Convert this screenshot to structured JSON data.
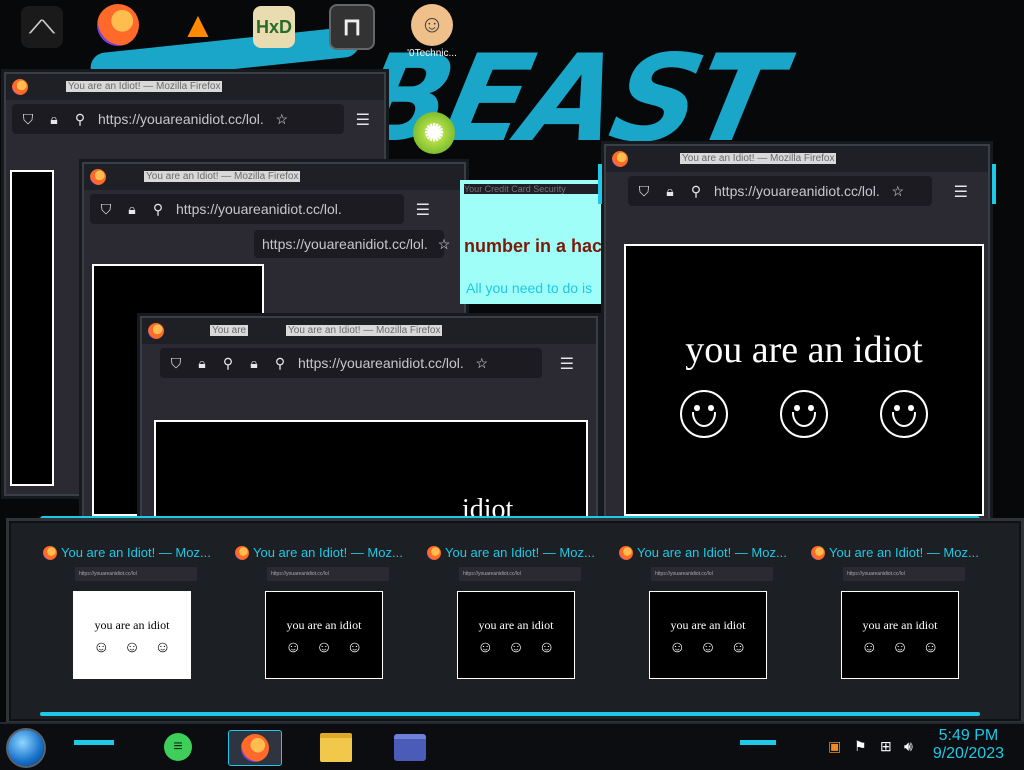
{
  "desktop": {
    "icons": [
      {
        "name": "app-shortcut-icon",
        "caption": ""
      },
      {
        "name": "firefox-shortcut-icon",
        "caption": ""
      },
      {
        "name": "vlc-shortcut-icon",
        "caption": ""
      },
      {
        "name": "hxd-shortcut-icon",
        "caption": ""
      },
      {
        "name": "map-shortcut-icon",
        "caption": ""
      },
      {
        "name": "technician-shortcut-icon",
        "caption": "'0Technic..."
      }
    ],
    "wallpaper_text": "BEAST"
  },
  "windows": {
    "w1": {
      "title": "You are an Idiot! — Mozilla Firefox",
      "url": "https://youareanidiot.cc/lol."
    },
    "w2": {
      "title": "You are an Idiot! — Mozilla Firefox",
      "url": "https://youareanidiot.cc/lol."
    },
    "w2b": {
      "url": "https://youareanidiot.cc/lol."
    },
    "w3": {
      "title": "You are an Idiot! — Mozilla Firefox",
      "title_fragment": "You are",
      "url": "https://youareanidiot.cc/lol."
    },
    "w4": {
      "title": "You are an Idiot! — Mozilla Firefox",
      "url": "https://youareanidiot.cc/lol.",
      "page_text": "you are an idiot"
    },
    "stray_text": "idiot"
  },
  "ad_popup": {
    "title": "Your Credit Card Security",
    "headline": "number in a hac",
    "body": "All you need to do is"
  },
  "previews": [
    {
      "title": "You are an Idiot! — Moz...",
      "url": "https://youareanidiot.cc/lol",
      "text": "you are an idiot",
      "inverted": true
    },
    {
      "title": "You are an Idiot! — Moz...",
      "url": "https://youareanidiot.cc/lol",
      "text": "you are an idiot",
      "inverted": false
    },
    {
      "title": "You are an Idiot! — Moz...",
      "url": "https://youareanidiot.cc/lol",
      "text": "you are an idiot",
      "inverted": false
    },
    {
      "title": "You are an Idiot! — Moz...",
      "url": "https://youareanidiot.cc/lol",
      "text": "you are an idiot",
      "inverted": false
    },
    {
      "title": "You are an Idiot! — Moz...",
      "url": "https://youareanidiot.cc/lol",
      "text": "you are an idiot",
      "inverted": false
    }
  ],
  "taskbar": {
    "apps": [
      {
        "name": "notes-app",
        "icon": "note-icon",
        "active": false
      },
      {
        "name": "firefox",
        "icon": "firefox-icon",
        "active": true
      },
      {
        "name": "file-explorer",
        "icon": "folder-icon",
        "active": false
      },
      {
        "name": "card-app",
        "icon": "card-icon",
        "active": false
      }
    ],
    "clock": {
      "time": "5:49 PM",
      "date": "9/20/2023"
    }
  },
  "colors": {
    "accent": "#1ec8e6",
    "ff_dark": "#2b2a33",
    "ad_bg": "#9ffff8"
  }
}
